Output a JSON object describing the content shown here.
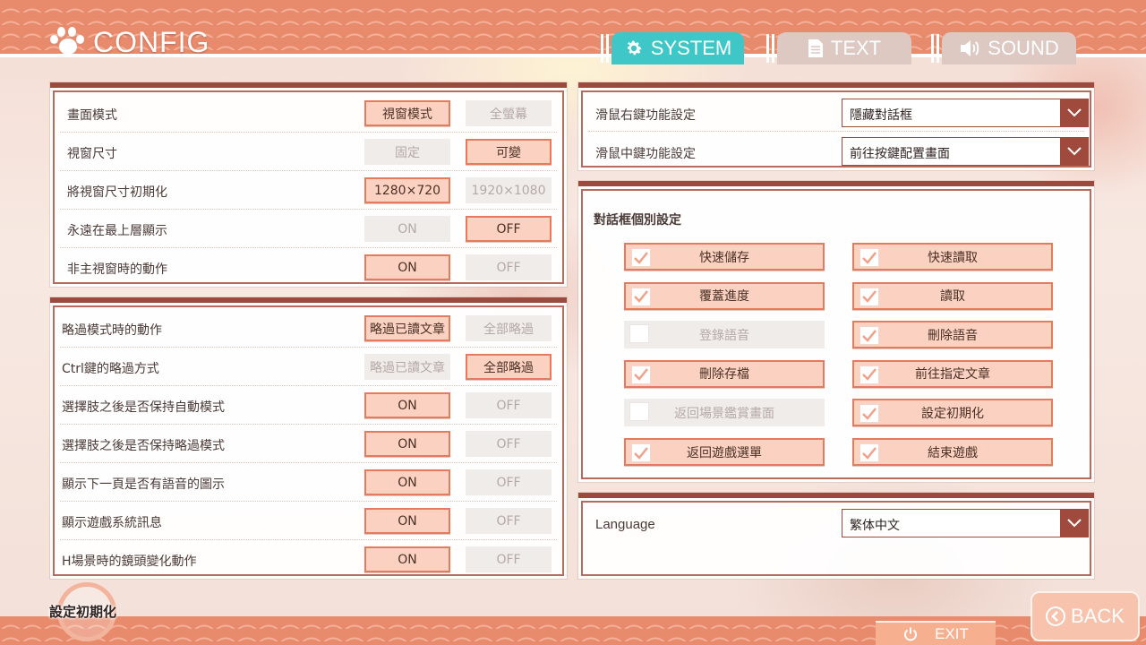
{
  "header": {
    "title": "CONFIG"
  },
  "tabs": [
    {
      "label": "SYSTEM",
      "active": true
    },
    {
      "label": "TEXT",
      "active": false
    },
    {
      "label": "SOUND",
      "active": false
    }
  ],
  "display_panel": {
    "rows": [
      {
        "label": "畫面模式",
        "a": "視窗模式",
        "b": "全螢幕",
        "selected": "a"
      },
      {
        "label": "視窗尺寸",
        "a": "固定",
        "b": "可變",
        "selected": "b"
      },
      {
        "label": "將視窗尺寸初期化",
        "a": "1280×720",
        "b": "1920×1080",
        "selected": "a"
      },
      {
        "label": "永遠在最上層顯示",
        "a": "ON",
        "b": "OFF",
        "selected": "b"
      },
      {
        "label": "非主視窗時的動作",
        "a": "ON",
        "b": "OFF",
        "selected": "a"
      }
    ]
  },
  "skip_panel": {
    "rows": [
      {
        "label": "略過模式時的動作",
        "a": "略過已讀文章",
        "b": "全部略過",
        "selected": "a"
      },
      {
        "label": "Ctrl鍵的略過方式",
        "a": "略過已讀文章",
        "b": "全部略過",
        "selected": "b"
      },
      {
        "label": "選擇肢之後是否保持自動模式",
        "a": "ON",
        "b": "OFF",
        "selected": "a"
      },
      {
        "label": "選擇肢之後是否保持略過模式",
        "a": "ON",
        "b": "OFF",
        "selected": "a"
      },
      {
        "label": "顯示下一頁是否有語音的圖示",
        "a": "ON",
        "b": "OFF",
        "selected": "a"
      },
      {
        "label": "顯示遊戲系統訊息",
        "a": "ON",
        "b": "OFF",
        "selected": "a"
      },
      {
        "label": "H場景時的鏡頭變化動作",
        "a": "ON",
        "b": "OFF",
        "selected": "a"
      }
    ]
  },
  "mouse_panel": {
    "rows": [
      {
        "label": "滑鼠右鍵功能設定",
        "value": "隱藏對話框"
      },
      {
        "label": "滑鼠中鍵功能設定",
        "value": "前往按鍵配置畫面"
      }
    ]
  },
  "dialog_panel": {
    "title": "對話框個別設定",
    "items": [
      {
        "label": "快速儲存",
        "checked": true
      },
      {
        "label": "快速讀取",
        "checked": true
      },
      {
        "label": "覆蓋進度",
        "checked": true
      },
      {
        "label": "讀取",
        "checked": true
      },
      {
        "label": "登錄語音",
        "checked": false
      },
      {
        "label": "刪除語音",
        "checked": true
      },
      {
        "label": "刪除存檔",
        "checked": true
      },
      {
        "label": "前往指定文章",
        "checked": true
      },
      {
        "label": "返回場景鑑賞畫面",
        "checked": false
      },
      {
        "label": "設定初期化",
        "checked": true
      },
      {
        "label": "返回遊戲選單",
        "checked": true
      },
      {
        "label": "結束遊戲",
        "checked": true
      }
    ]
  },
  "language_panel": {
    "label": "Language",
    "value": "繁体中文"
  },
  "footer": {
    "reset_label": "設定初期化",
    "exit_label": "EXIT",
    "back_label": "BACK"
  },
  "colors": {
    "accent_active_tab": "#3fc7c8",
    "selected_fill": "#fbd2c1",
    "selected_border": "#e57b5e",
    "panel_header": "#9b4a3e",
    "band": "#e88a6c"
  },
  "icons": {
    "title": "paw-icon",
    "system_tab": "gear-icon",
    "text_tab": "document-icon",
    "sound_tab": "speaker-icon",
    "dropdown": "chevron-down-icon",
    "checkbox": "check-icon",
    "exit": "power-icon",
    "back": "back-arrow-icon"
  }
}
